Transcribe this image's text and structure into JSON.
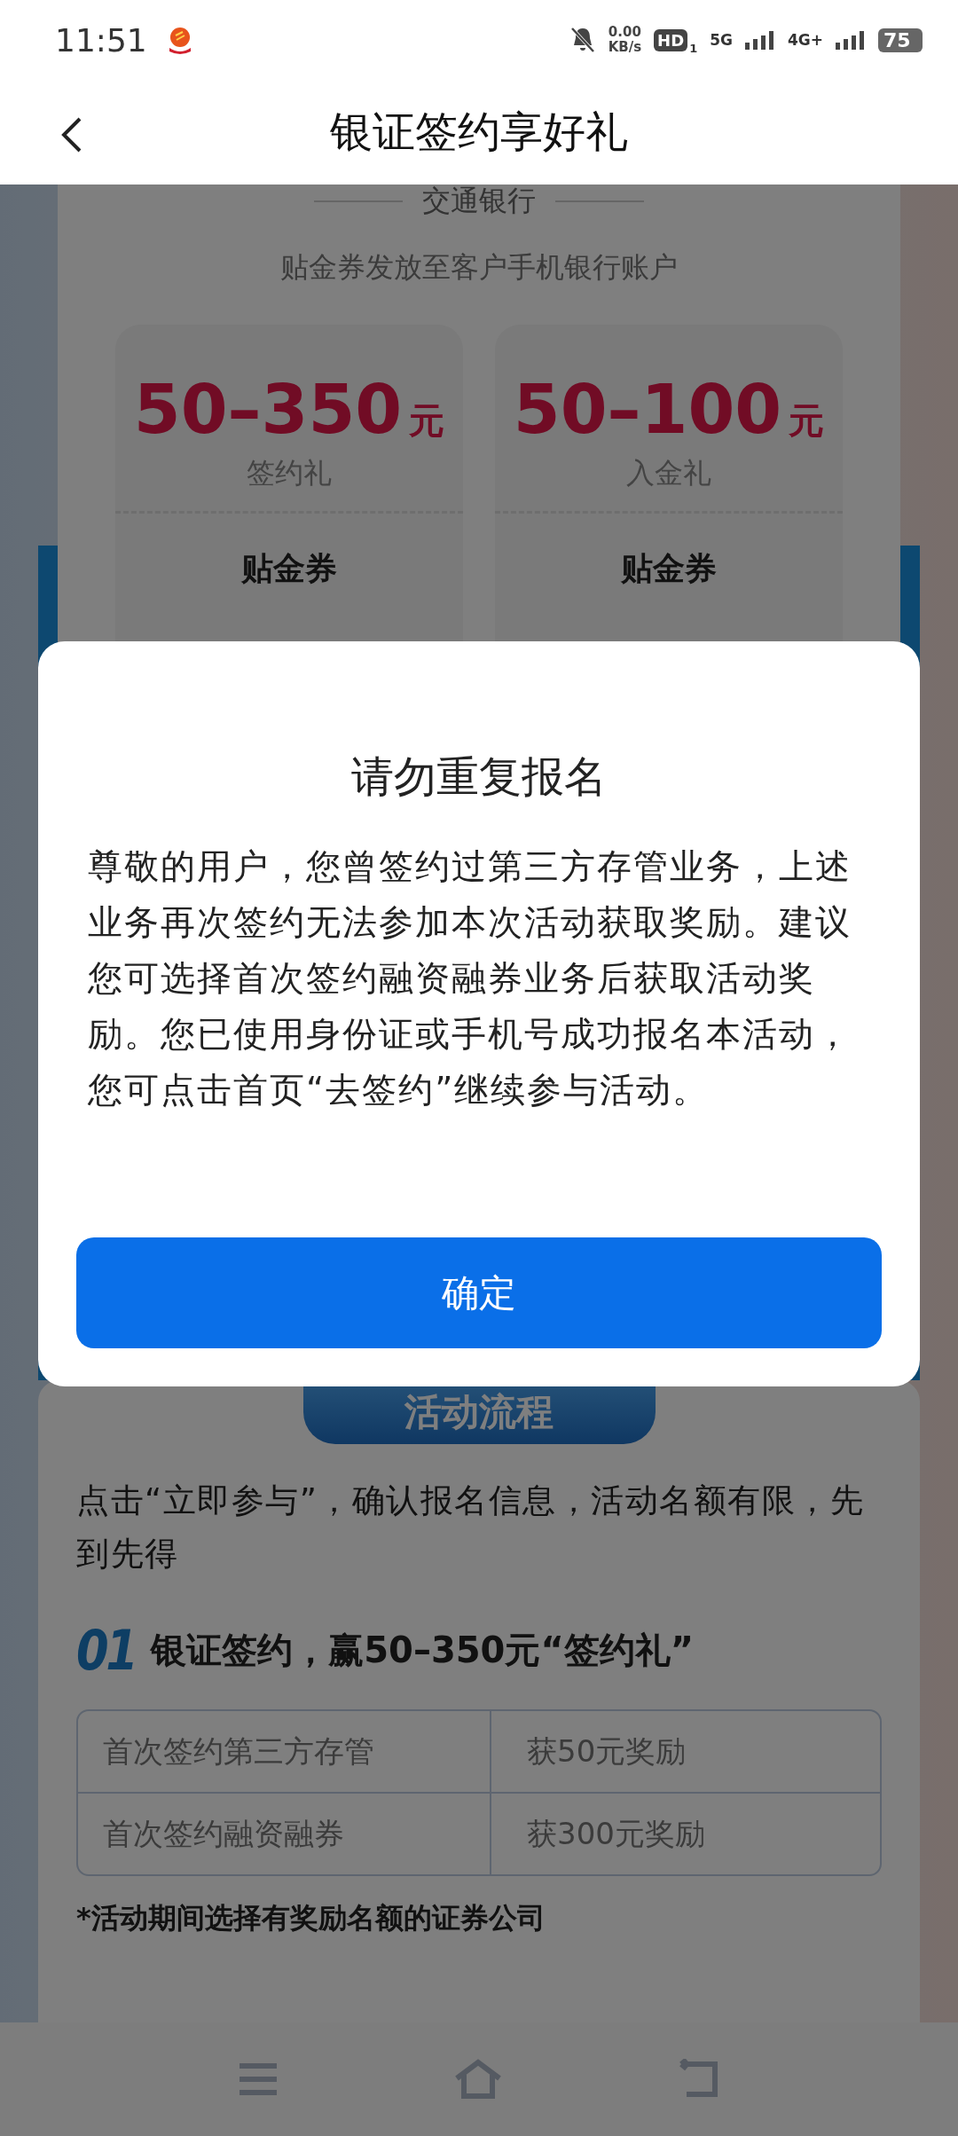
{
  "status_bar": {
    "time": "11:51",
    "net_speed": "0.00",
    "net_unit": "KB/s",
    "hd": "HD",
    "sim": "1",
    "network_1": "5G",
    "network_2": "4G+",
    "battery": "75"
  },
  "header": {
    "title": "银证签约享好礼"
  },
  "page": {
    "bank": "交通银行",
    "subtitle": "贴金券发放至客户手机银行账户",
    "coupons": [
      {
        "amount": "50–350",
        "unit": "元",
        "label": "签约礼",
        "type": "贴金券"
      },
      {
        "amount": "50–100",
        "unit": "元",
        "label": "入金礼",
        "type": "贴金券"
      }
    ],
    "section_title": "活动流程",
    "intro": "点击“立即参与”，确认报名信息，活动名额有限，先到先得",
    "step": {
      "number": "01",
      "title": "银证签约，赢50–350元“签约礼”"
    },
    "table": [
      [
        "首次签约第三方存管",
        "获50元奖励"
      ],
      [
        "首次签约融资融券",
        "获300元奖励"
      ]
    ],
    "footnote": "*活动期间选择有奖励名额的证券公司"
  },
  "dialog": {
    "title": "请勿重复报名",
    "body": "尊敬的用户，您曾签约过第三方存管业务，上述业务再次签约无法参加本次活动获取奖励。建议您可选择首次签约融资融券业务后获取活动奖励。您已使用身份证或手机号成功报名本活动，您可点击首页“去签约”继续参与活动。",
    "button": "确定"
  }
}
